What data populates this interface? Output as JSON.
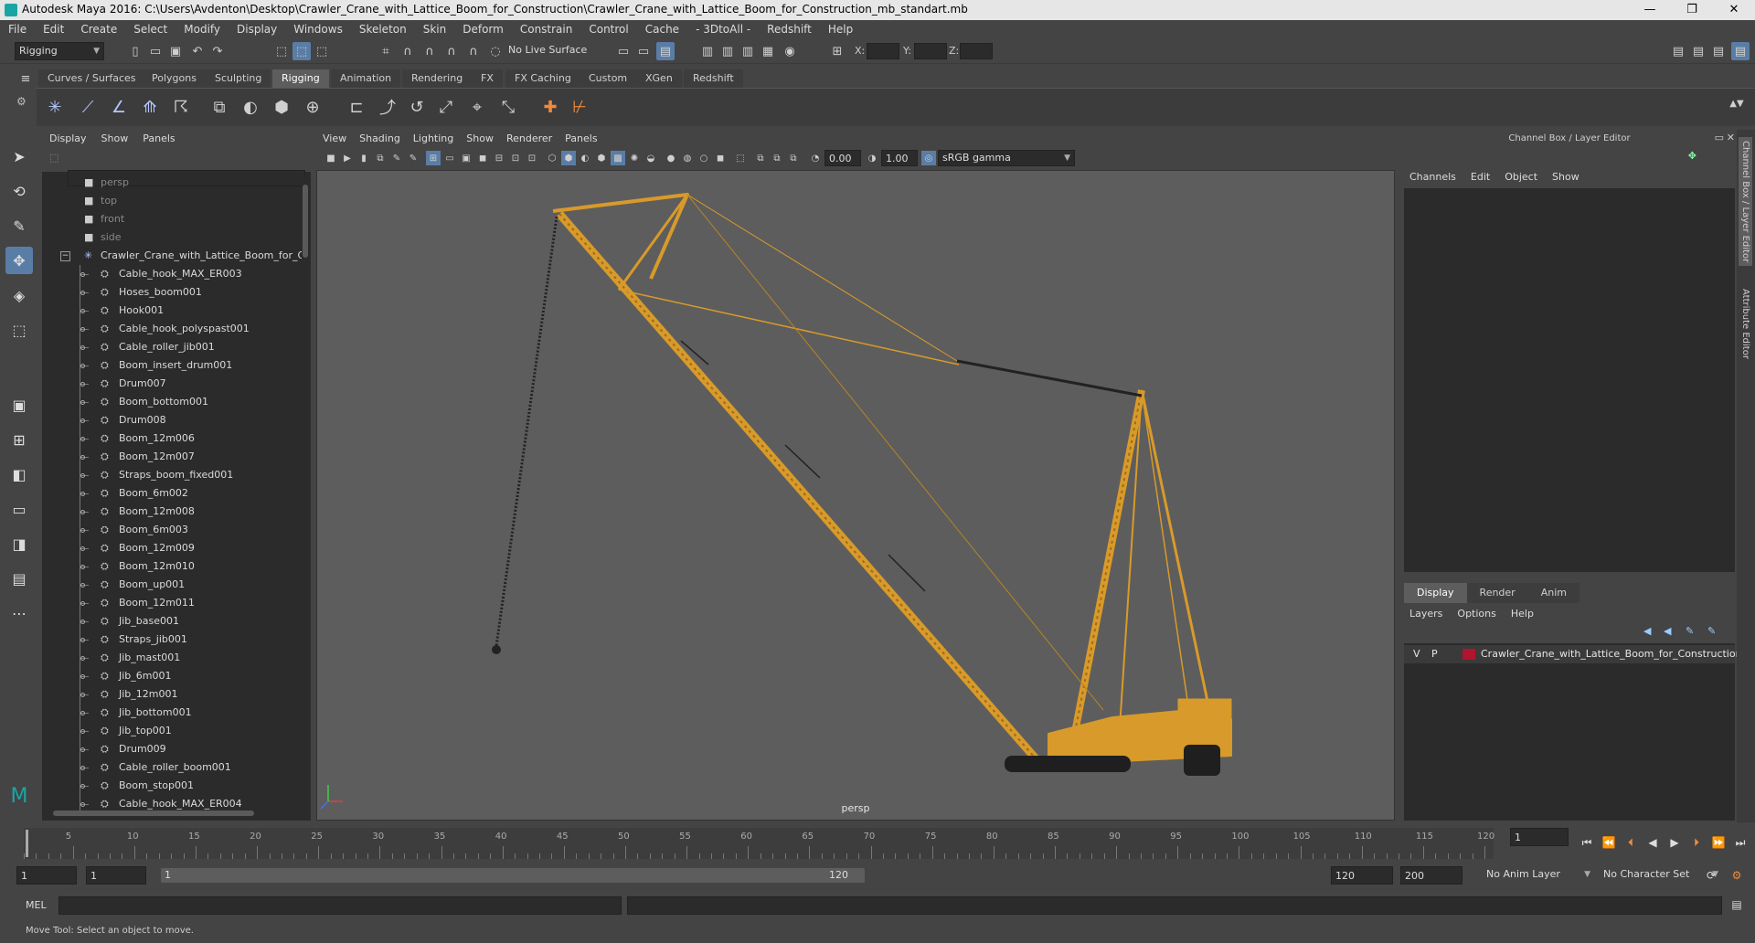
{
  "window": {
    "title": "Autodesk Maya 2016: C:\\Users\\Avdenton\\Desktop\\Crawler_Crane_with_Lattice_Boom_for_Construction\\Crawler_Crane_with_Lattice_Boom_for_Construction_mb_standart.mb",
    "minimize": "—",
    "maximize": "❐",
    "close": "✕"
  },
  "menubar": [
    "File",
    "Edit",
    "Create",
    "Select",
    "Modify",
    "Display",
    "Windows",
    "Skeleton",
    "Skin",
    "Deform",
    "Constrain",
    "Control",
    "Cache",
    "- 3DtoAll -",
    "Redshift",
    "Help"
  ],
  "statusline": {
    "mode": "Rigging",
    "live_surface": "No Live Surface",
    "x_label": "X:",
    "y_label": "Y:",
    "z_label": "Z:"
  },
  "shelf_tabs": [
    "Curves / Surfaces",
    "Polygons",
    "Sculpting",
    "Rigging",
    "Animation",
    "Rendering",
    "FX",
    "FX Caching",
    "Custom",
    "XGen",
    "Redshift"
  ],
  "shelf_active": "Rigging",
  "outliner": {
    "menus": [
      "Display",
      "Show",
      "Panels"
    ],
    "cameras": [
      "persp",
      "top",
      "front",
      "side"
    ],
    "group": "Crawler_Crane_with_Lattice_Boom_for_Cor",
    "items": [
      "Cable_hook_MAX_ER003",
      "Hoses_boom001",
      "Hook001",
      "Cable_hook_polyspast001",
      "Cable_roller_jib001",
      "Boom_insert_drum001",
      "Drum007",
      "Boom_bottom001",
      "Drum008",
      "Boom_12m006",
      "Boom_12m007",
      "Straps_boom_fixed001",
      "Boom_6m002",
      "Boom_12m008",
      "Boom_6m003",
      "Boom_12m009",
      "Boom_12m010",
      "Boom_up001",
      "Boom_12m011",
      "Jib_base001",
      "Straps_jib001",
      "Jib_mast001",
      "Jib_6m001",
      "Jib_12m001",
      "Jib_bottom001",
      "Jib_top001",
      "Drum009",
      "Cable_roller_boom001",
      "Boom_stop001",
      "Cable_hook_MAX_ER004"
    ]
  },
  "viewport": {
    "menus": [
      "View",
      "Shading",
      "Lighting",
      "Show",
      "Renderer",
      "Panels"
    ],
    "exposure": "0.00",
    "gamma": "1.00",
    "color_space": "sRGB gamma",
    "camera": "persp"
  },
  "channelbox": {
    "header": "Channel Box / Layer Editor",
    "menus": [
      "Channels",
      "Edit",
      "Object",
      "Show"
    ],
    "layer_tabs": [
      "Display",
      "Render",
      "Anim"
    ],
    "layer_menus": [
      "Layers",
      "Options",
      "Help"
    ],
    "layer": {
      "v": "V",
      "p": "P",
      "name": "Crawler_Crane_with_Lattice_Boom_for_Construction",
      "color": "#b0142f"
    },
    "side_tabs": [
      "Channel Box / Layer Editor",
      "Attribute Editor"
    ]
  },
  "timeline": {
    "ticks": [
      "5",
      "10",
      "15",
      "20",
      "25",
      "30",
      "35",
      "40",
      "45",
      "50",
      "55",
      "60",
      "65",
      "70",
      "75",
      "80",
      "85",
      "90",
      "95",
      "100",
      "105",
      "110",
      "115",
      "120"
    ],
    "start_label": "1",
    "current_frame": "1"
  },
  "range": {
    "start": "1",
    "playback_start": "1",
    "range_start": "1",
    "range_end": "120",
    "playback_end": "120",
    "end": "200",
    "anim_layer": "No Anim Layer",
    "character_set": "No Character Set"
  },
  "cmdline": {
    "label": "MEL"
  },
  "help": "Move Tool: Select an object to move.",
  "colors": {
    "crane": "#d89a2a",
    "viewport_bg": "#5d5d5d",
    "selection": "#5a7da6"
  }
}
